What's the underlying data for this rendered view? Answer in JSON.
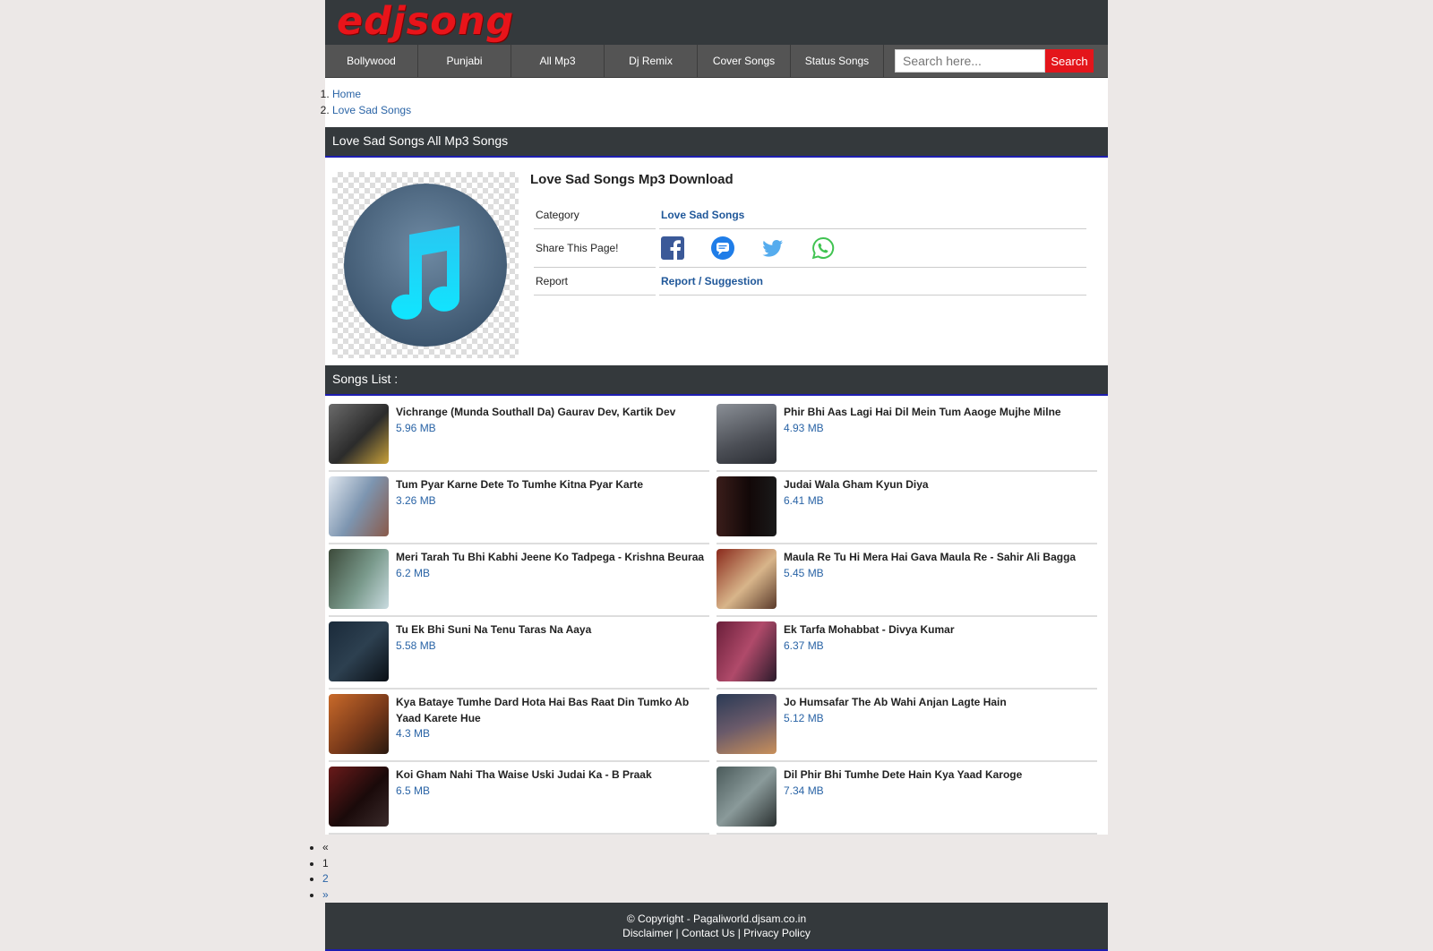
{
  "site": {
    "logo_text": "edjsong"
  },
  "nav": {
    "items": [
      "Bollywood",
      "Punjabi",
      "All Mp3",
      "Dj Remix",
      "Cover Songs",
      "Status Songs"
    ],
    "search_placeholder": "Search here...",
    "search_button": "Search"
  },
  "breadcrumb": [
    "Home",
    "Love Sad Songs"
  ],
  "section_title": "Love Sad Songs All Mp3 Songs",
  "album": {
    "title": "Love Sad Songs Mp3 Download",
    "category_label": "Category",
    "category_value": "Love Sad Songs",
    "share_label": "Share This Page!",
    "report_label": "Report",
    "report_value": "Report / Suggestion",
    "share_icons": [
      "facebook-icon",
      "sms-icon",
      "twitter-icon",
      "whatsapp-icon"
    ]
  },
  "songs_heading": "Songs List :",
  "songs": [
    {
      "name": "Vichrange (Munda Southall Da) Gaurav Dev, Kartik Dev",
      "size": "5.96 MB"
    },
    {
      "name": "Phir Bhi Aas Lagi Hai Dil Mein Tum Aaoge Mujhe Milne",
      "size": "4.93 MB"
    },
    {
      "name": "Tum Pyar Karne Dete To Tumhe Kitna Pyar Karte",
      "size": "3.26 MB"
    },
    {
      "name": "Judai Wala Gham Kyun Diya",
      "size": "6.41 MB"
    },
    {
      "name": "Meri Tarah Tu Bhi Kabhi Jeene Ko Tadpega - Krishna Beuraa",
      "size": "6.2 MB"
    },
    {
      "name": "Maula Re Tu Hi Mera Hai Gava Maula Re - Sahir Ali Bagga",
      "size": "5.45 MB"
    },
    {
      "name": "Tu Ek Bhi Suni Na Tenu Taras Na Aaya",
      "size": "5.58 MB"
    },
    {
      "name": "Ek Tarfa Mohabbat - Divya Kumar",
      "size": "6.37 MB"
    },
    {
      "name": "Kya Bataye Tumhe Dard Hota Hai Bas Raat Din Tumko Ab Yaad Karete Hue",
      "size": "4.3 MB"
    },
    {
      "name": "Jo Humsafar The Ab Wahi Anjan Lagte Hain",
      "size": "5.12 MB"
    },
    {
      "name": "Koi Gham Nahi Tha Waise Uski Judai Ka - B Praak",
      "size": "6.5 MB"
    },
    {
      "name": "Dil Phir Bhi Tumhe Dete Hain Kya Yaad Karoge",
      "size": "7.34 MB"
    }
  ],
  "pagination": [
    "«",
    "1",
    "2",
    "»"
  ],
  "footer": {
    "copyright": "© Copyright - Pagaliworld.djsam.co.in",
    "links": [
      "Disclaimer",
      "Contact Us",
      "Privacy Policy"
    ]
  },
  "colors": {
    "header_bg": "#34393c",
    "nav_bg": "#545454",
    "accent_red": "#e4151b",
    "link_blue": "#2a64a6",
    "underline_blue": "#1d1db0"
  }
}
